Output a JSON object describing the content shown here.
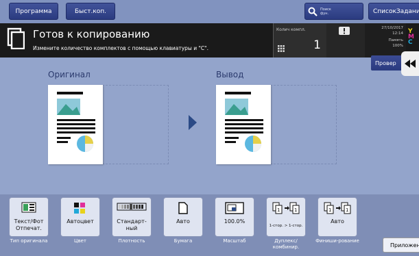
{
  "top_bar": {
    "program_label": "Программа",
    "quick_copy_label": "Быст.коп.",
    "search_label_1": "Поиск",
    "search_label_2": "фун.",
    "job_list_label": "СписокЗадани"
  },
  "status": {
    "title": "Готов к копированию",
    "message": "Измените количество комплектов с помощью клавиатуры и \"C\".",
    "sets_label": "Колич компл.",
    "sets_value": "1",
    "date": "27/10/2017",
    "time": "12:14",
    "memory_label": "Память",
    "memory_value": "100%",
    "toner": [
      "Y",
      "M",
      "C"
    ]
  },
  "check_button_label": "Провер",
  "preview": {
    "original_label": "Оригинал",
    "output_label": "Вывод"
  },
  "functions": [
    {
      "label": "Текст/Фот Отпечат.",
      "caption": "Тип оригинала",
      "icon": "text-photo-icon"
    },
    {
      "label": "Автоцвет",
      "caption": "Цвет",
      "icon": "color-icon"
    },
    {
      "label": "Стандарт-ный",
      "caption": "Плотность",
      "icon": "density-icon"
    },
    {
      "label": "Авто",
      "caption": "Бумага",
      "icon": "paper-icon"
    },
    {
      "label": "100.0%",
      "caption": "Масштаб",
      "icon": "zoom-icon"
    },
    {
      "label": "1-стор. > 1-стор.",
      "caption": "Дуплекс/ комбинир.",
      "icon": "duplex-icon"
    },
    {
      "label": "Авто",
      "caption": "Финиши-рование",
      "icon": "finishing-icon"
    }
  ],
  "applications_label": "Приложени",
  "colors": {
    "background": "#8c9ec6",
    "status_band": "#1a1a1a",
    "button_blue": "#2b3b80",
    "toner_y": "#e8d21b",
    "toner_m": "#e0309a",
    "toner_c": "#20a8d8"
  }
}
